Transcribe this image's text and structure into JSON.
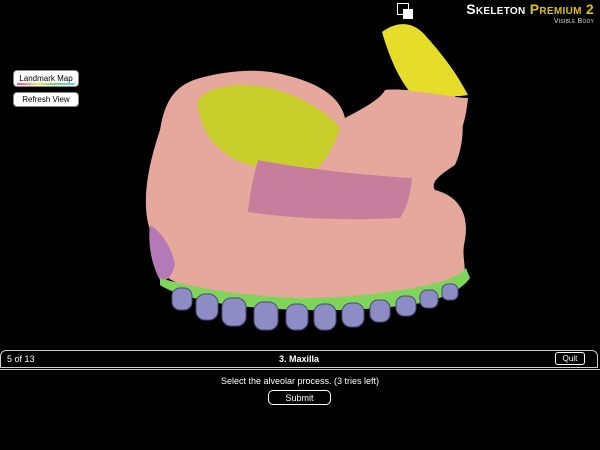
{
  "brand": {
    "title_part1": "Skeleton",
    "title_part2": "Premium 2",
    "subtitle": "Visible Body",
    "accent": "#e0c200"
  },
  "sidebar": {
    "landmark_map_label": "Landmark Map",
    "refresh_view_label": "Refresh View"
  },
  "quiz": {
    "progress": "5 of 13",
    "title": "3. Maxilla",
    "quit_label": "Quit",
    "prompt": "Select the alveolar process. (3 tries left)",
    "submit_label": "Submit"
  },
  "model": {
    "bone_color": "#e6a79c",
    "orbital_surface_color": "#c9cf2a",
    "frontal_process_color": "#e6dd2a",
    "palatine_color": "#c77e9c",
    "zygomatic_color": "#b579b8",
    "alveolar_color": "#7fd45a",
    "teeth_color": "#8e8cc4"
  }
}
